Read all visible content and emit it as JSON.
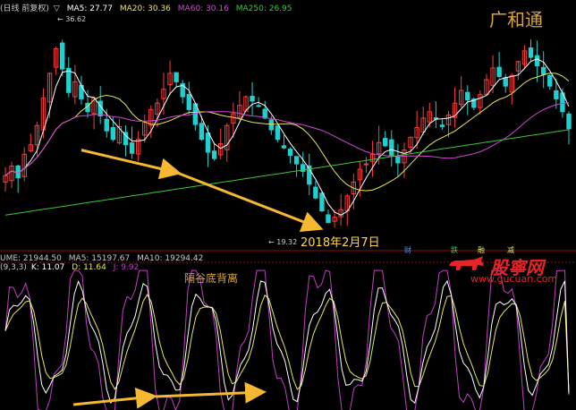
{
  "watermark_title": "广和通",
  "main_panel": {
    "header": {
      "name": "(日线 前复权)",
      "icon": "triangle-down-icon",
      "ma5": "MA5: 27.77",
      "ma20": "MA20: 30.36",
      "ma60": "MA60: 30.16",
      "ma250": "MA250: 26.95"
    },
    "high_label": "36.62",
    "low_label": "19.32",
    "annotation_date": "2018年2月7日",
    "event_markers": [
      "财",
      "跌",
      "融",
      "减"
    ]
  },
  "volume_header": {
    "volume": "UME: 21944.50",
    "ma5": "MA5: 15197.67",
    "ma10": "MA10: 19294.42"
  },
  "kdj_header": {
    "params": "(9,3,3)",
    "k": "K: 11.07",
    "d": "D: 11.64",
    "j": "J: 9.92"
  },
  "annotation_divergence": "隔谷底背离",
  "logo": {
    "name": "股寧网",
    "url": "www.gucuan.com"
  },
  "colors": {
    "up": "#ff3b3b",
    "down": "#20d0d0",
    "ma5": "#ffffff",
    "ma20": "#e8e85a",
    "ma60": "#d048d0",
    "ma250": "#38c838",
    "k": "#ffffff",
    "d": "#e8e85a",
    "j": "#c040c0",
    "arrow": "#f5b830",
    "grid": "#8b1010"
  },
  "chart_data": [
    {
      "type": "candlestick",
      "title": "广和通",
      "ylim": [
        17.5,
        39.5
      ],
      "y_max_label": 36.62,
      "y_min_label": 19.32,
      "series": [
        {
          "name": "MA5",
          "last": 27.77
        },
        {
          "name": "MA20",
          "last": 30.36
        },
        {
          "name": "MA60",
          "last": 30.16
        },
        {
          "name": "MA250",
          "last": 26.95
        }
      ],
      "closes": [
        24.2,
        25.1,
        24.0,
        26.2,
        27.1,
        28.9,
        31.5,
        33.8,
        36.1,
        34.2,
        32.0,
        33.0,
        31.4,
        30.2,
        31.5,
        29.8,
        28.4,
        27.6,
        28.8,
        27.1,
        26.3,
        27.6,
        29.2,
        30.4,
        31.0,
        32.3,
        33.8,
        33.0,
        31.6,
        30.4,
        29.0,
        27.6,
        26.4,
        25.8,
        27.2,
        28.9,
        30.0,
        30.8,
        31.6,
        31.2,
        30.7,
        29.6,
        28.5,
        27.6,
        26.8,
        26.1,
        25.3,
        24.6,
        23.4,
        22.1,
        20.9,
        19.8,
        20.3,
        21.0,
        22.3,
        23.6,
        24.8,
        25.3,
        26.2,
        27.3,
        27.0,
        26.1,
        25.4,
        26.6,
        27.8,
        28.7,
        29.6,
        30.2,
        29.5,
        28.8,
        29.9,
        31.0,
        32.2,
        31.3,
        30.6,
        31.8,
        33.2,
        34.3,
        33.5,
        32.6,
        33.6,
        34.9,
        35.9,
        35.3,
        34.5,
        33.7,
        32.6,
        31.4,
        30.2,
        28.6
      ],
      "annotation_lows": [
        26.6,
        24.5,
        19.32
      ]
    },
    {
      "type": "line",
      "title": "KDJ(9,3,3)",
      "ylim": [
        0,
        100
      ],
      "series": [
        {
          "name": "K",
          "last": 11.07
        },
        {
          "name": "D",
          "last": 11.64
        },
        {
          "name": "J",
          "last": 9.92
        }
      ],
      "annotation": "隔谷底背离"
    }
  ]
}
